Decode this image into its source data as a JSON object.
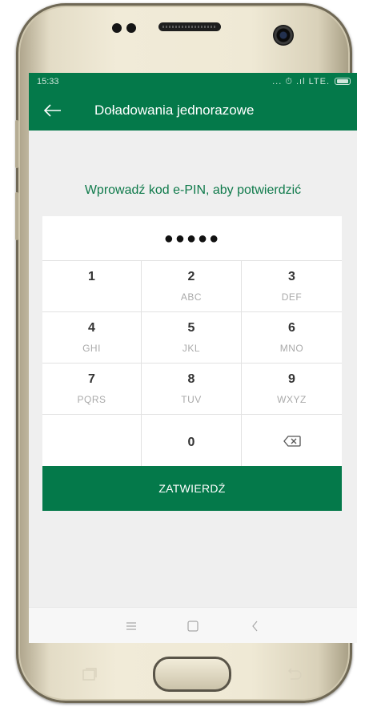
{
  "status_bar": {
    "time": "15:33",
    "icons_text": "... ⏱ .ıl LTE."
  },
  "header": {
    "title": "Doładowania jednorazowe",
    "back_icon": "back-arrow-icon"
  },
  "pin": {
    "prompt": "Wprowadź kod e-PIN, aby potwierdzić",
    "masked_value": "●●●●●"
  },
  "keypad": {
    "keys": [
      {
        "digit": "1",
        "letters": ""
      },
      {
        "digit": "2",
        "letters": "ABC"
      },
      {
        "digit": "3",
        "letters": "DEF"
      },
      {
        "digit": "4",
        "letters": "GHI"
      },
      {
        "digit": "5",
        "letters": "JKL"
      },
      {
        "digit": "6",
        "letters": "MNO"
      },
      {
        "digit": "7",
        "letters": "PQRS"
      },
      {
        "digit": "8",
        "letters": "TUV"
      },
      {
        "digit": "9",
        "letters": "WXYZ"
      }
    ],
    "zero": "0",
    "backspace_icon": "backspace-icon"
  },
  "actions": {
    "confirm_label": "ZATWIERDŹ"
  },
  "colors": {
    "brand_green": "#04794a",
    "prompt_green": "#0f7a4b",
    "screen_bg": "#efefef"
  }
}
